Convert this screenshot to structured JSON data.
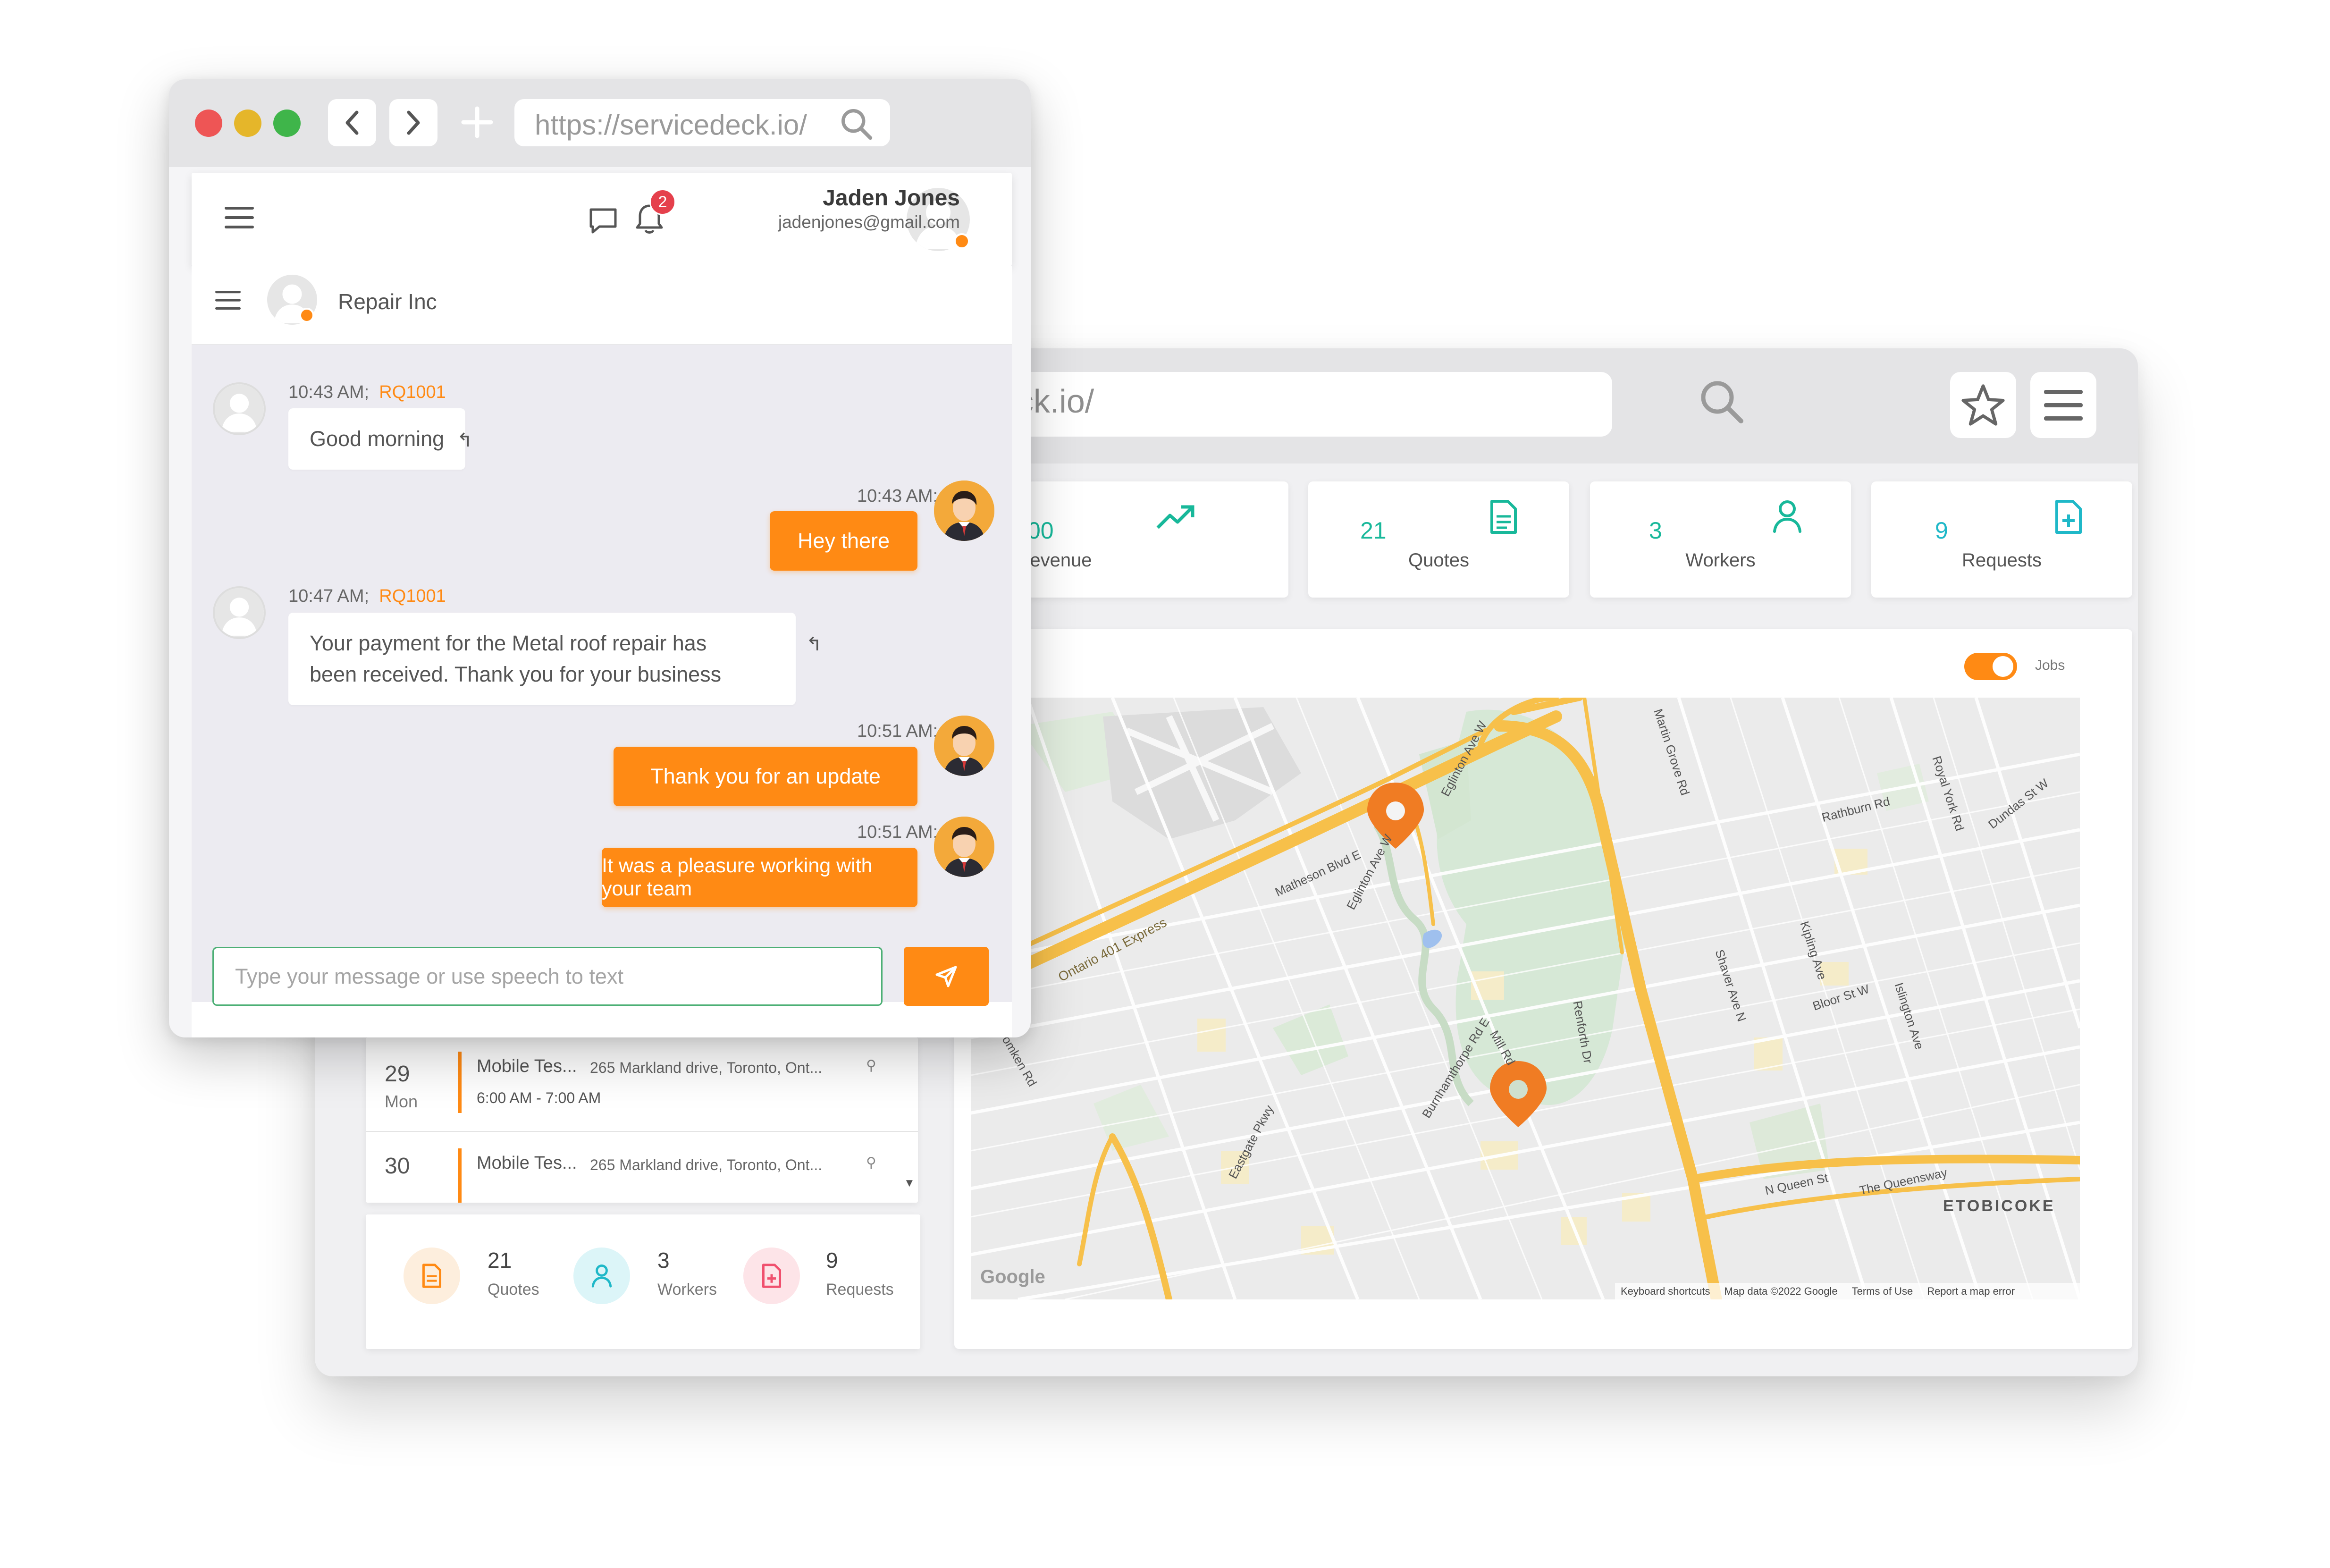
{
  "back_window": {
    "url_text": "deck.io/",
    "stats": [
      {
        "value": "00",
        "label": "Revenue"
      },
      {
        "value": "21",
        "label": "Quotes"
      },
      {
        "value": "3",
        "label": "Workers"
      },
      {
        "value": "9",
        "label": "Requests"
      }
    ],
    "map": {
      "toggle_label": "Jobs",
      "toggle_on": true,
      "labels": {
        "etobicoke": "ETOBICOKE",
        "ontario_401": "Ontario 401 Express",
        "eglinton_w": "Eglinton Ave W",
        "eglinton_e": "Eglinton Ave W",
        "matheson": "Matheson Blvd E",
        "martin_grove": "Martin Grove Rd",
        "rathburn": "Rathburn Rd",
        "dundas_w": "Dundas St W",
        "royal_york": "Royal York Rd",
        "bloor_w": "Bloor St W",
        "queen": "N Queen St",
        "queensway": "The Queensway",
        "kipling": "Kipling Ave",
        "islington": "Islington Ave",
        "shaver": "Shaver Ave N",
        "tomken": "Tomken Rd",
        "eastgate": "Eastgate Pkwy",
        "burnhamthorpe": "Burnhamthorpe Rd E",
        "mill": "Mill Rd",
        "renforth": "Renforth Dr",
        "google_logo": "Google",
        "footer_shortcuts": "Keyboard shortcuts",
        "footer_data": "Map data ©2022 Google",
        "footer_terms": "Terms of Use",
        "footer_report": "Report a map error"
      }
    },
    "schedule": [
      {
        "day": "29",
        "weekday": "Mon",
        "title": "Mobile Tes...",
        "address": "265 Markland drive, Toronto, Ont...",
        "time": "6:00 AM - 7:00 AM"
      },
      {
        "day": "30",
        "weekday": "",
        "title": "Mobile Tes...",
        "address": "265 Markland drive, Toronto, Ont...",
        "time": ""
      }
    ],
    "summary": [
      {
        "value": "21",
        "label": "Quotes",
        "color": "#ff8a14",
        "bg": "#fdeedd"
      },
      {
        "value": "3",
        "label": "Workers",
        "color": "#1fb8c8",
        "bg": "#dcf5f8"
      },
      {
        "value": "9",
        "label": "Requests",
        "color": "#f0506e",
        "bg": "#fde4e8"
      }
    ]
  },
  "front_window": {
    "url": "https://servicedeck.io/",
    "notifications_count": "2",
    "user": {
      "name": "Jaden Jones",
      "email": "jadenjones@gmail.com"
    },
    "chat_title": "Repair Inc",
    "messages": [
      {
        "dir": "in",
        "time": "10:43 AM;",
        "ref": "RQ1001",
        "lines": [
          "Good morning"
        ]
      },
      {
        "dir": "out",
        "time": "10:43 AM;",
        "text": "Hey there"
      },
      {
        "dir": "in",
        "time": "10:47 AM;",
        "ref": "RQ1001",
        "lines": [
          "Your payment for the Metal roof repair has",
          "been received. Thank you for your business"
        ]
      },
      {
        "dir": "out",
        "time": "10:51 AM;",
        "text": "Thank you for an update"
      },
      {
        "dir": "out",
        "time": "10:51 AM;",
        "text": "It was a pleasure working with your team"
      }
    ],
    "input_placeholder": "Type your message or use speech to text"
  },
  "colors": {
    "accent": "#ff8a14",
    "green": "#18b89a",
    "map_road": "#f7c04a"
  }
}
